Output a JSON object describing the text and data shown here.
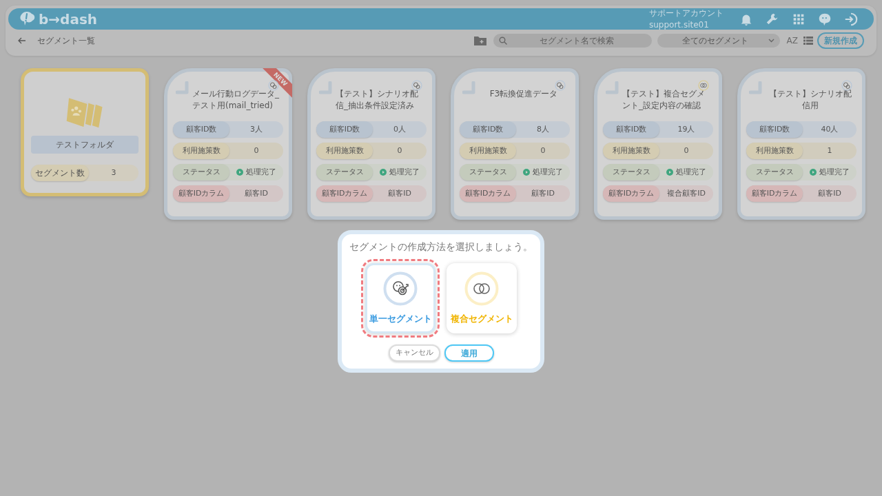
{
  "header": {
    "logo": "b→dash",
    "account_name": "サポートアカウント",
    "account_id": "support.site01"
  },
  "toolbar": {
    "title": "セグメント一覧",
    "search": {
      "placeholder": "セグメント名で検索"
    },
    "filter": "全てのセグメント",
    "sort_label": "AZ",
    "new_button": "新規作成"
  },
  "folders": [
    {
      "name": "テストフォルダ",
      "stat_label": "セグメント数",
      "stat_value": "3"
    }
  ],
  "segments": [
    {
      "title": "メール行動ログデータ_テスト用(mail_tried)",
      "kind": "single",
      "badge": "NEW",
      "rows": [
        {
          "kind": "count",
          "label": "顧客ID数",
          "value": "3人"
        },
        {
          "kind": "usage",
          "label": "利用施策数",
          "value": "0"
        },
        {
          "kind": "status",
          "label": "ステータス",
          "value": "処理完了"
        },
        {
          "kind": "column",
          "label": "顧客IDカラム",
          "value": "顧客ID"
        }
      ]
    },
    {
      "title": "【テスト】シナリオ配信_抽出条件設定済み",
      "kind": "single",
      "rows": [
        {
          "kind": "count",
          "label": "顧客ID数",
          "value": "0人"
        },
        {
          "kind": "usage",
          "label": "利用施策数",
          "value": "0"
        },
        {
          "kind": "status",
          "label": "ステータス",
          "value": "処理完了"
        },
        {
          "kind": "column",
          "label": "顧客IDカラム",
          "value": "顧客ID"
        }
      ]
    },
    {
      "title": "F3転換促進データ",
      "kind": "single",
      "rows": [
        {
          "kind": "count",
          "label": "顧客ID数",
          "value": "8人"
        },
        {
          "kind": "usage",
          "label": "利用施策数",
          "value": "0"
        },
        {
          "kind": "status",
          "label": "ステータス",
          "value": "処理完了"
        },
        {
          "kind": "column",
          "label": "顧客IDカラム",
          "value": "顧客ID"
        }
      ]
    },
    {
      "title": "【テスト】複合セグメント_設定内容の確認",
      "kind": "composite",
      "rows": [
        {
          "kind": "count",
          "label": "顧客ID数",
          "value": "19人"
        },
        {
          "kind": "usage",
          "label": "利用施策数",
          "value": "0"
        },
        {
          "kind": "status",
          "label": "ステータス",
          "value": "処理完了"
        },
        {
          "kind": "column",
          "label": "顧客IDカラム",
          "value": "複合顧客ID"
        }
      ]
    },
    {
      "title": "【テスト】シナリオ配信用",
      "kind": "single",
      "rows": [
        {
          "kind": "count",
          "label": "顧客ID数",
          "value": "40人"
        },
        {
          "kind": "usage",
          "label": "利用施策数",
          "value": "1"
        },
        {
          "kind": "status",
          "label": "ステータス",
          "value": "処理完了"
        },
        {
          "kind": "column",
          "label": "顧客IDカラム",
          "value": "顧客ID"
        }
      ]
    }
  ],
  "dialog": {
    "title": "セグメントの作成方法を選択しましょう。",
    "options": [
      {
        "kind": "single",
        "label": "単一セグメント",
        "selected": true
      },
      {
        "kind": "composite",
        "label": "複合セグメント",
        "selected": false
      }
    ],
    "cancel_button": "キャンセル",
    "apply_button": "適用"
  }
}
